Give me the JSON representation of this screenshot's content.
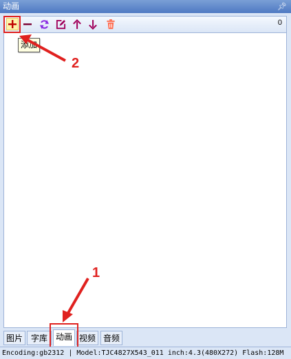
{
  "panel": {
    "title": "动画",
    "pin_icon": "pin-icon"
  },
  "toolbar": {
    "buttons": [
      {
        "name": "add-icon",
        "tooltip": "添加",
        "color": "#c00000"
      },
      {
        "name": "remove-icon",
        "color": "#7a0033"
      },
      {
        "name": "refresh-icon",
        "color": "#8a2be2"
      },
      {
        "name": "edit-icon",
        "color": "#a0005a"
      },
      {
        "name": "move-up-icon",
        "color": "#a0005a"
      },
      {
        "name": "move-down-icon",
        "color": "#a0005a"
      },
      {
        "name": "delete-icon",
        "color": "#ff6a4d"
      }
    ],
    "count": "0"
  },
  "tooltip": {
    "text": "添加"
  },
  "tabs": [
    {
      "label": "图片",
      "active": false
    },
    {
      "label": "字库",
      "active": false
    },
    {
      "label": "动画",
      "active": true
    },
    {
      "label": "视频",
      "active": false
    },
    {
      "label": "音频",
      "active": false
    }
  ],
  "annotations": {
    "step1": "1",
    "step2": "2",
    "color": "#e0211f"
  },
  "statusbar": {
    "text": "Encoding:gb2312  | Model:TJC4827X543_011  inch:4.3(480X272) Flash:128M"
  }
}
